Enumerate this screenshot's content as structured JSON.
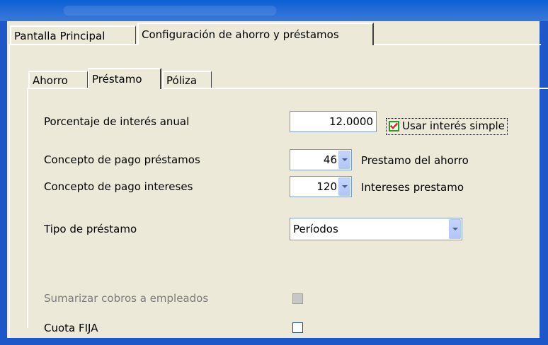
{
  "tabs": {
    "main": "Pantalla Principal",
    "config": "Configuración de ahorro y préstamos"
  },
  "subtabs": {
    "ahorro": "Ahorro",
    "prestamo": "Préstamo",
    "poliza": "Póliza"
  },
  "form": {
    "interest_label": "Porcentaje de interés anual",
    "interest_value": "12.0000",
    "simple_interest_label": "Usar interés simple",
    "simple_interest_checked": true,
    "loan_concept_label": "Concepto de pago préstamos",
    "loan_concept_value": "46",
    "loan_concept_desc": "Prestamo del ahorro",
    "interest_concept_label": "Concepto de pago intereses",
    "interest_concept_value": "120",
    "interest_concept_desc": "Intereses prestamo",
    "loan_type_label": "Tipo de préstamo",
    "loan_type_value": "Períodos",
    "summarize_label": "Sumarizar cobros a empleados",
    "summarize_checked": false,
    "fixed_fee_label": "Cuota FIJA",
    "fixed_fee_checked": false
  },
  "colors": {
    "window_bg": "#ece9d8",
    "frame": "#1d57c8",
    "checkmark": "#e0261b",
    "check_border": "#21a121"
  }
}
